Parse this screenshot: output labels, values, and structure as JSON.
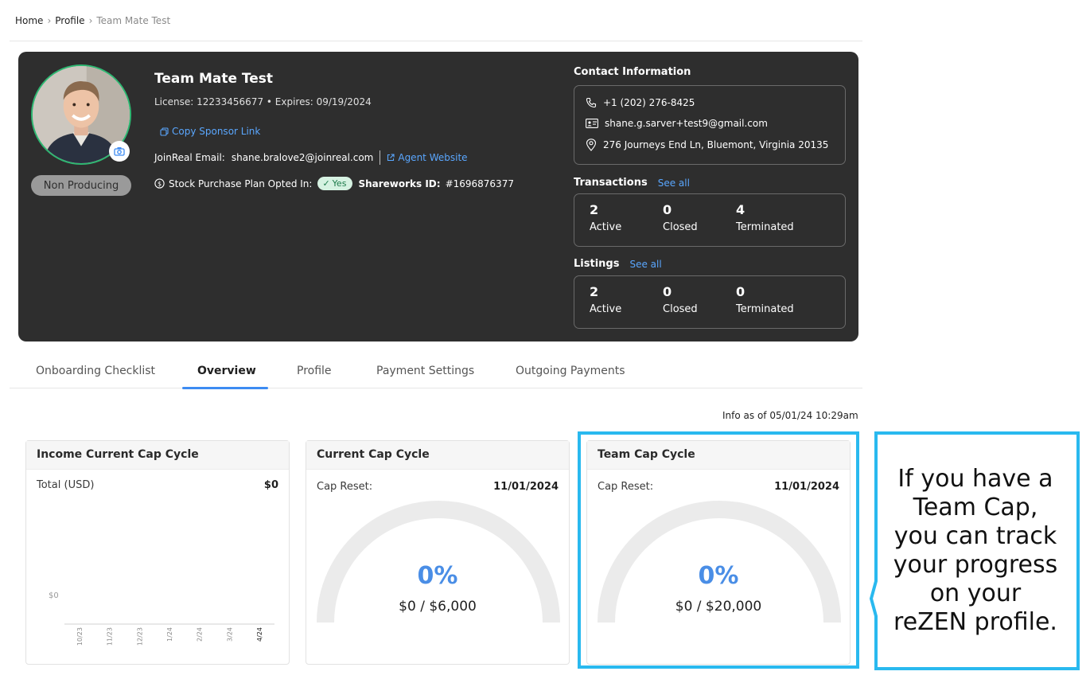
{
  "breadcrumb": [
    {
      "label": "Home"
    },
    {
      "label": "Profile"
    },
    {
      "label": "Team Mate Test"
    }
  ],
  "agent": {
    "name": "Team Mate Test",
    "license_line": "License: 12233456677  •  Expires: 09/19/2024",
    "status_badge": "Non Producing",
    "copy_sponsor_link": "Copy Sponsor Link",
    "joinreal_email_label": "JoinReal Email:",
    "joinreal_email": "shane.bralove2@joinreal.com",
    "agent_website": "Agent Website",
    "stock_plan_label": "Stock Purchase Plan Opted In:",
    "stock_plan_value": "Yes",
    "shareworks_label": "Shareworks ID:",
    "shareworks_id": "#1696876377"
  },
  "contact": {
    "title": "Contact Information",
    "phone": "+1 (202) 276-8425",
    "email": "shane.g.sarver+test9@gmail.com",
    "address": "276 Journeys End Ln, Bluemont, Virginia 20135"
  },
  "transactions": {
    "title": "Transactions",
    "see_all": "See all",
    "stats": [
      {
        "value": "2",
        "label": "Active"
      },
      {
        "value": "0",
        "label": "Closed"
      },
      {
        "value": "4",
        "label": "Terminated"
      }
    ]
  },
  "listings": {
    "title": "Listings",
    "see_all": "See all",
    "stats": [
      {
        "value": "2",
        "label": "Active"
      },
      {
        "value": "0",
        "label": "Closed"
      },
      {
        "value": "0",
        "label": "Terminated"
      }
    ]
  },
  "tabs": [
    {
      "label": "Onboarding Checklist"
    },
    {
      "label": "Overview"
    },
    {
      "label": "Profile"
    },
    {
      "label": "Payment Settings"
    },
    {
      "label": "Outgoing Payments"
    }
  ],
  "active_tab": "Overview",
  "info_as_of": "Info as of 05/01/24 10:29am",
  "income_panel": {
    "title": "Income Current Cap Cycle",
    "total_label": "Total (USD)",
    "total_value": "$0",
    "chart_data": {
      "type": "bar",
      "categories": [
        "10/23",
        "11/23",
        "12/23",
        "1/24",
        "2/24",
        "3/24",
        "4/24"
      ],
      "values": [
        0,
        0,
        0,
        0,
        0,
        0,
        0
      ],
      "y_tick_label": "$0"
    }
  },
  "current_cap_panel": {
    "title": "Current Cap Cycle",
    "reset_label": "Cap Reset:",
    "reset_date": "11/01/2024",
    "percent": "0%",
    "progress_fraction": 0,
    "amount": "$0 / $6,000"
  },
  "team_cap_panel": {
    "title": "Team Cap Cycle",
    "reset_label": "Cap Reset:",
    "reset_date": "11/01/2024",
    "percent": "0%",
    "progress_fraction": 0,
    "amount": "$0 / $20,000"
  },
  "callout": {
    "text": "If you have a Team Cap, you can track your progress on your reZEN profile."
  },
  "colors": {
    "card_bg": "#2e2e2e",
    "accent_blue": "#3d8bf2",
    "link_blue": "#5aa7ff",
    "highlight_cyan": "#29b9ef",
    "avatar_ring": "#2eb872",
    "gauge_track": "#ebebeb"
  }
}
